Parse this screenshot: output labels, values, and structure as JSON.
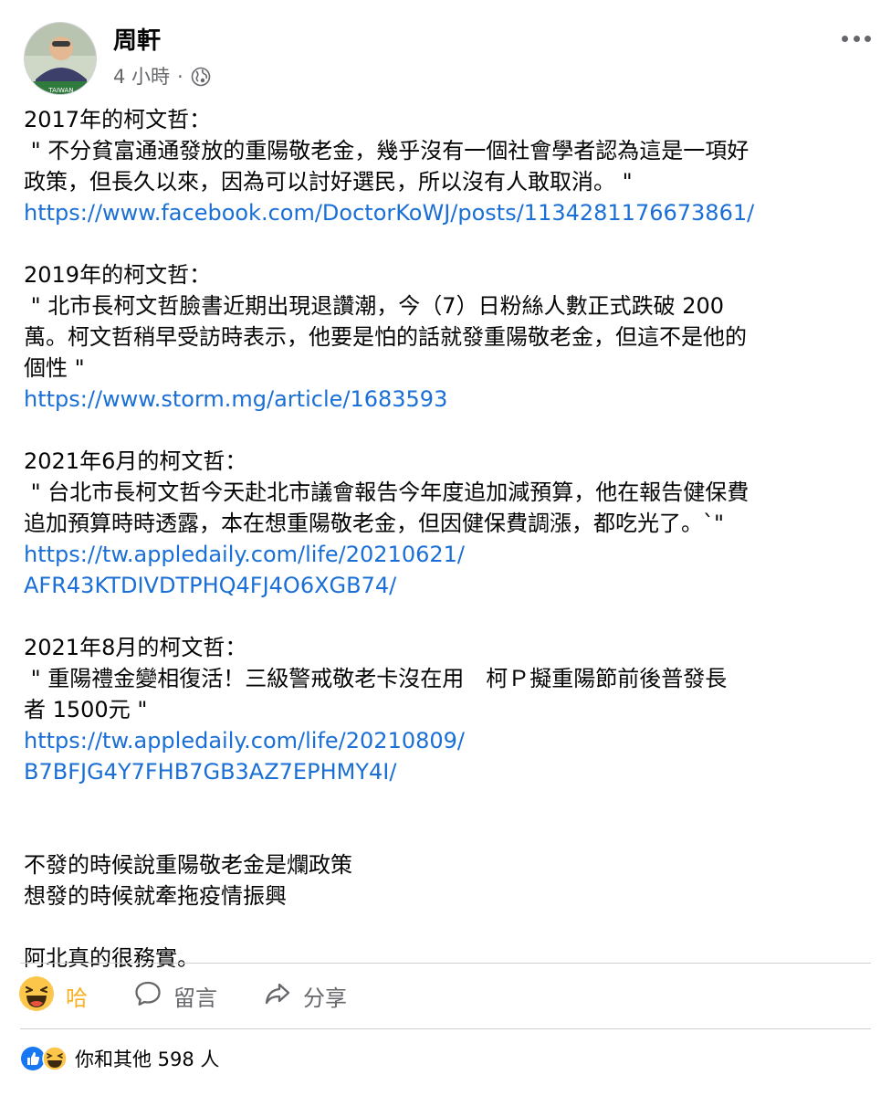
{
  "post": {
    "author": "周軒",
    "time": "4 小時",
    "separator": "·",
    "avatar_badge": "TAIWAN"
  },
  "content": {
    "blocks": [
      {
        "lines": [
          "2017年的柯文哲：",
          " \" 不分貧富通通發放的重陽敬老金，幾乎沒有一個社會學者認為這是一項好",
          "政策，但長久以來，因為可以討好選民，所以沒有人敢取消。 \""
        ],
        "links": [
          "https://www.facebook.com/DoctorKoWJ/posts/1134281176673861/"
        ]
      },
      {
        "lines": [
          "2019年的柯文哲：",
          " \" 北市長柯文哲臉書近期出現退讚潮，今（7）日粉絲人數正式跌破 200",
          "萬。柯文哲稍早受訪時表示，他要是怕的話就發重陽敬老金，但這不是他的",
          "個性 \""
        ],
        "links": [
          "https://www.storm.mg/article/1683593"
        ]
      },
      {
        "lines": [
          "2021年6月的柯文哲：",
          " \" 台北市長柯文哲今天赴北市議會報告今年度追加減預算，他在報告健保費",
          "追加預算時時透露，本在想重陽敬老金，但因健保費調漲，都吃光了。`\""
        ],
        "links": [
          "https://tw.appledaily.com/life/20210621/",
          "AFR43KTDIVDTPHQ4FJ4O6XGB74/"
        ]
      },
      {
        "lines": [
          "2021年8月的柯文哲：",
          " \" 重陽禮金變相復活！三級警戒敬老卡沒在用　柯Ｐ擬重陽節前後普發長",
          "者 1500元 \""
        ],
        "links": [
          "https://tw.appledaily.com/life/20210809/",
          "B7BFJG4Y7FHB7GB3AZ7EPHMY4I/"
        ]
      }
    ],
    "closing": [
      "不發的時候說重陽敬老金是爛政策",
      "想發的時候就牽拖疫情振興"
    ],
    "final": "阿北真的很務實。"
  },
  "actions": {
    "haha_label": "哈",
    "comment_label": "留言",
    "share_label": "分享"
  },
  "reactions": {
    "summary": "你和其他 598 人"
  },
  "colors": {
    "link": "#1a6fd6",
    "haha": "#f7b125",
    "like": "#1877f2",
    "muted": "#65676b"
  }
}
